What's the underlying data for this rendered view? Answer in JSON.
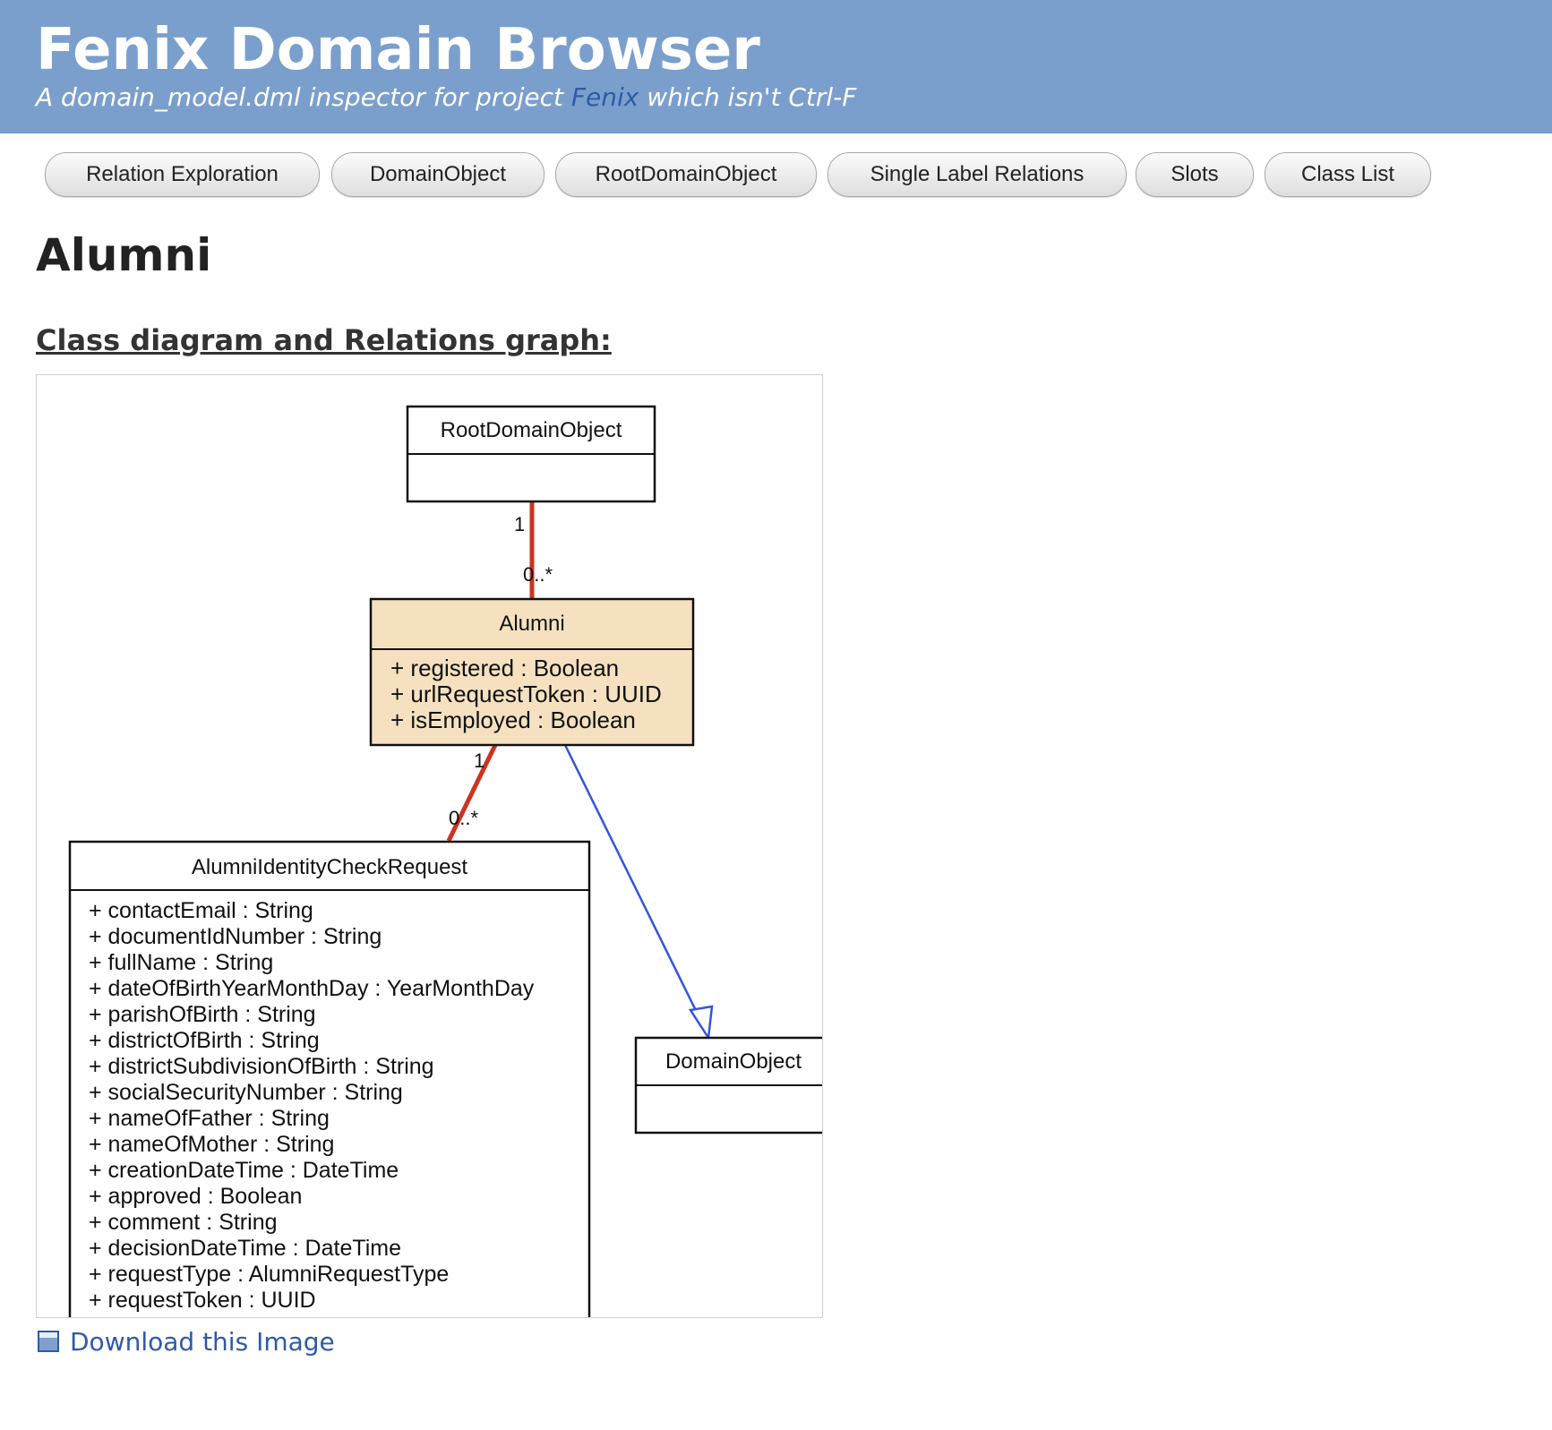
{
  "header": {
    "title": "Fenix Domain Browser",
    "subtitle_prefix": "A domain_model.dml inspector for project ",
    "subtitle_project": "Fenix",
    "subtitle_suffix": " which isn't Ctrl-F"
  },
  "nav": {
    "items": [
      {
        "label": "Relation Exploration"
      },
      {
        "label": "DomainObject"
      },
      {
        "label": "RootDomainObject"
      },
      {
        "label": "Single Label Relations"
      },
      {
        "label": "Slots"
      },
      {
        "label": "Class List"
      }
    ]
  },
  "page": {
    "title": "Alumni",
    "section_title": "Class diagram and Relations graph:"
  },
  "diagram": {
    "classes": {
      "root": {
        "name": "RootDomainObject",
        "attributes": []
      },
      "alumni": {
        "name": "Alumni",
        "attributes": [
          "+ registered : Boolean",
          "+ urlRequestToken : UUID",
          "+ isEmployed : Boolean"
        ]
      },
      "request": {
        "name": "AlumniIdentityCheckRequest",
        "attributes": [
          "+ contactEmail : String",
          "+ documentIdNumber : String",
          "+ fullName : String",
          "+ dateOfBirthYearMonthDay : YearMonthDay",
          "+ parishOfBirth : String",
          "+ districtOfBirth : String",
          "+ districtSubdivisionOfBirth : String",
          "+ socialSecurityNumber : String",
          "+ nameOfFather : String",
          "+ nameOfMother : String",
          "+ creationDateTime : DateTime",
          "+ approved : Boolean",
          "+ comment : String",
          "+ decisionDateTime : DateTime",
          "+ requestType : AlumniRequestType",
          "+ requestToken : UUID"
        ]
      },
      "domain": {
        "name": "DomainObject",
        "attributes": []
      }
    },
    "relations": {
      "root_alumni": {
        "source_mult": "1",
        "target_mult": "0..*"
      },
      "alumni_request": {
        "source_mult": "1",
        "target_mult": "0..*"
      }
    },
    "colors": {
      "relation": "#cc3322",
      "inheritance": "#3355dd",
      "highlight_fill": "#f5e1c0"
    }
  },
  "download": {
    "label": "Download this Image",
    "icon": "image-icon"
  }
}
